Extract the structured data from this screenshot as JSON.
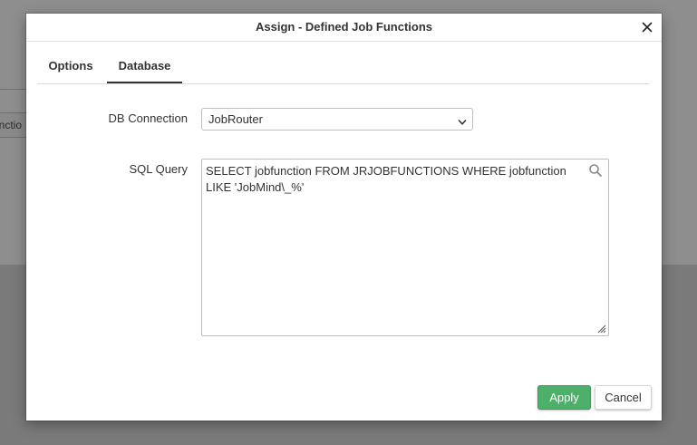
{
  "background": {
    "partial_field_text": "unctio"
  },
  "dialog": {
    "title": "Assign - Defined Job Functions",
    "close_icon": "close-icon",
    "tabs": [
      {
        "label": "Options",
        "active": false
      },
      {
        "label": "Database",
        "active": true
      }
    ],
    "db_connection": {
      "label": "DB Connection",
      "value": "JobRouter",
      "icon": "chevron-down-icon"
    },
    "sql_query": {
      "label": "SQL Query",
      "value": "SELECT jobfunction FROM JRJOBFUNCTIONS WHERE jobfunction LIKE 'JobMind\\_%'",
      "icon": "search-icon"
    },
    "buttons": {
      "apply": "Apply",
      "cancel": "Cancel"
    }
  },
  "colors": {
    "apply_button": "#4caf6a",
    "overlay": "#7a7a7a",
    "active_tab_underline": "#333333"
  }
}
